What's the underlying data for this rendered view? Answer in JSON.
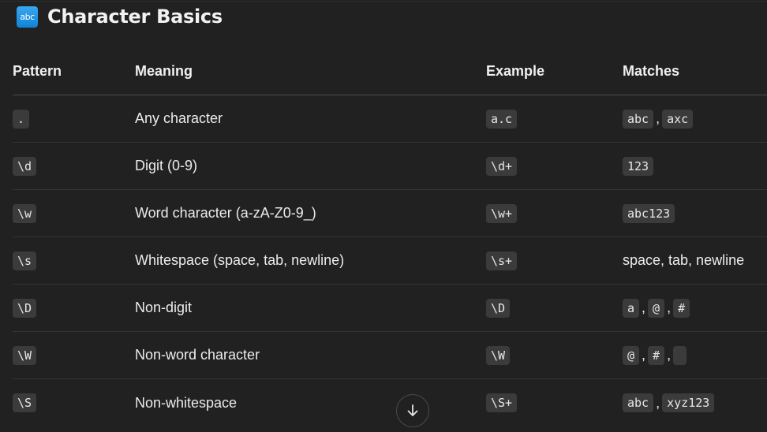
{
  "section": {
    "icon": "abc-icon",
    "icon_text": "abc",
    "title": "Character Basics"
  },
  "table": {
    "headers": [
      "Pattern",
      "Meaning",
      "Example",
      "Matches"
    ],
    "rows": [
      {
        "pattern": ".",
        "meaning": "Any character",
        "example": "a.c",
        "matches": [
          "abc",
          "axc"
        ]
      },
      {
        "pattern": "\\d",
        "meaning": "Digit (0-9)",
        "example": "\\d+",
        "matches": [
          "123"
        ]
      },
      {
        "pattern": "\\w",
        "meaning": "Word character (a-zA-Z0-9_)",
        "example": "\\w+",
        "matches": [
          "abc123"
        ]
      },
      {
        "pattern": "\\s",
        "meaning": "Whitespace (space, tab, newline)",
        "example": "\\s+",
        "matches_text": "space, tab, newline"
      },
      {
        "pattern": "\\D",
        "meaning": "Non-digit",
        "example": "\\D",
        "matches": [
          "a",
          "@",
          "#"
        ]
      },
      {
        "pattern": "\\W",
        "meaning": "Non-word character",
        "example": "\\W",
        "matches": [
          "@",
          "#",
          " "
        ]
      },
      {
        "pattern": "\\S",
        "meaning": "Non-whitespace",
        "example": "\\S+",
        "matches": [
          "abc",
          "xyz123"
        ]
      }
    ]
  },
  "scroll_button": {
    "icon": "arrow-down-icon"
  }
}
